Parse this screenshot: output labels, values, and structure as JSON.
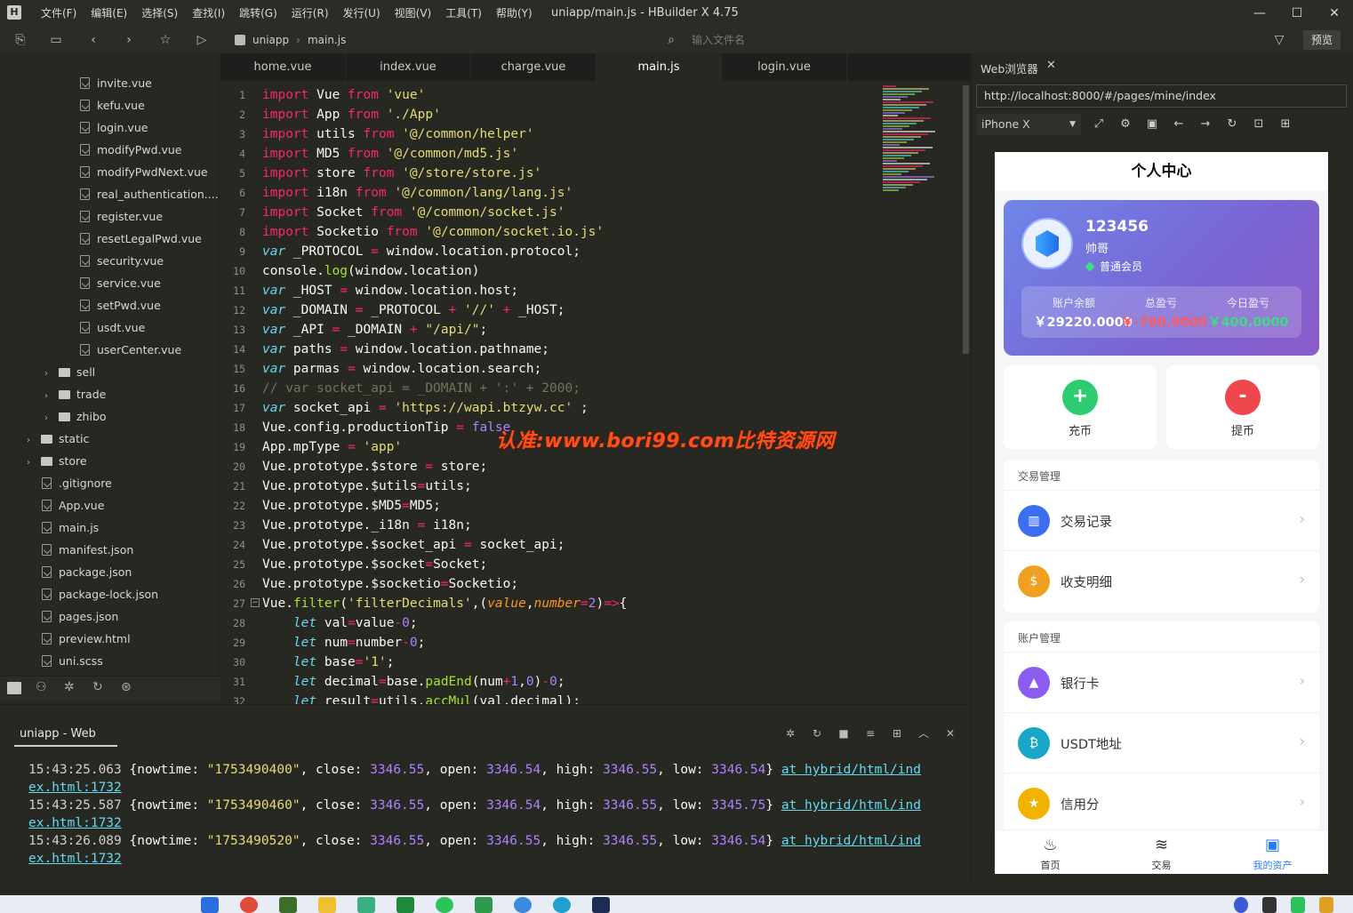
{
  "window": {
    "title": "uniapp/main.js - HBuilder X 4.75",
    "logo": "H",
    "menu": [
      "文件(F)",
      "编辑(E)",
      "选择(S)",
      "查找(I)",
      "跳转(G)",
      "运行(R)",
      "发行(U)",
      "视图(V)",
      "工具(T)",
      "帮助(Y)"
    ]
  },
  "toolbar": {
    "breadcrumb": [
      "uniapp",
      "main.js"
    ],
    "file_search_placeholder": "输入文件名",
    "preview_label": "预览"
  },
  "sidebar": {
    "files": [
      {
        "name": "invite.vue",
        "type": "file",
        "indent": 2
      },
      {
        "name": "kefu.vue",
        "type": "file",
        "indent": 2
      },
      {
        "name": "login.vue",
        "type": "file",
        "indent": 2
      },
      {
        "name": "modifyPwd.vue",
        "type": "file",
        "indent": 2
      },
      {
        "name": "modifyPwdNext.vue",
        "type": "file",
        "indent": 2
      },
      {
        "name": "real_authentication....",
        "type": "file",
        "indent": 2
      },
      {
        "name": "register.vue",
        "type": "file",
        "indent": 2
      },
      {
        "name": "resetLegalPwd.vue",
        "type": "file",
        "indent": 2
      },
      {
        "name": "security.vue",
        "type": "file",
        "indent": 2
      },
      {
        "name": "service.vue",
        "type": "file",
        "indent": 2
      },
      {
        "name": "setPwd.vue",
        "type": "file",
        "indent": 2
      },
      {
        "name": "usdt.vue",
        "type": "file",
        "indent": 2
      },
      {
        "name": "userCenter.vue",
        "type": "file",
        "indent": 2
      },
      {
        "name": "sell",
        "type": "folder",
        "indent": 1
      },
      {
        "name": "trade",
        "type": "folder",
        "indent": 1
      },
      {
        "name": "zhibo",
        "type": "folder",
        "indent": 1
      },
      {
        "name": "static",
        "type": "folder",
        "indent": 0
      },
      {
        "name": "store",
        "type": "folder",
        "indent": 0
      },
      {
        "name": ".gitignore",
        "type": "plain",
        "indent": 0
      },
      {
        "name": "App.vue",
        "type": "file",
        "indent": 0
      },
      {
        "name": "main.js",
        "type": "file",
        "indent": 0
      },
      {
        "name": "manifest.json",
        "type": "json",
        "indent": 0
      },
      {
        "name": "package.json",
        "type": "json",
        "indent": 0
      },
      {
        "name": "package-lock.json",
        "type": "json",
        "indent": 0
      },
      {
        "name": "pages.json",
        "type": "json",
        "indent": 0
      },
      {
        "name": "preview.html",
        "type": "html",
        "indent": 0
      },
      {
        "name": "uni.scss",
        "type": "scss",
        "indent": 0
      }
    ]
  },
  "editor": {
    "tabs": [
      "home.vue",
      "index.vue",
      "charge.vue",
      "main.js",
      "login.vue"
    ],
    "active_tab": "main.js",
    "line_numbers": [
      "1",
      "2",
      "3",
      "4",
      "5",
      "6",
      "7",
      "8",
      "9",
      "10",
      "11",
      "12",
      "13",
      "14",
      "15",
      "16",
      "17",
      "18",
      "19",
      "20",
      "21",
      "22",
      "23",
      "24",
      "25",
      "26",
      "27",
      "28",
      "29",
      "30",
      "31",
      "32"
    ],
    "lines": [
      [
        [
          "k",
          "import"
        ],
        [
          "t",
          " Vue "
        ],
        [
          "k",
          "from"
        ],
        [
          "t",
          " "
        ],
        [
          "s",
          "'vue'"
        ]
      ],
      [
        [
          "k",
          "import"
        ],
        [
          "t",
          " App "
        ],
        [
          "k",
          "from"
        ],
        [
          "t",
          " "
        ],
        [
          "s",
          "'./App'"
        ]
      ],
      [
        [
          "k",
          "import"
        ],
        [
          "t",
          " utils "
        ],
        [
          "k",
          "from"
        ],
        [
          "t",
          " "
        ],
        [
          "s",
          "'@/common/helper'"
        ]
      ],
      [
        [
          "k",
          "import"
        ],
        [
          "t",
          " MD5 "
        ],
        [
          "k",
          "from"
        ],
        [
          "t",
          " "
        ],
        [
          "s",
          "'@/common/md5.js'"
        ]
      ],
      [
        [
          "k",
          "import"
        ],
        [
          "t",
          " store "
        ],
        [
          "k",
          "from"
        ],
        [
          "t",
          " "
        ],
        [
          "s",
          "'@/store/store.js'"
        ]
      ],
      [
        [
          "k",
          "import"
        ],
        [
          "t",
          " i18n "
        ],
        [
          "k",
          "from"
        ],
        [
          "t",
          " "
        ],
        [
          "s",
          "'@/common/lang/lang.js'"
        ]
      ],
      [
        [
          "k",
          "import"
        ],
        [
          "t",
          " Socket "
        ],
        [
          "k",
          "from"
        ],
        [
          "t",
          " "
        ],
        [
          "s",
          "'@/common/socket.js'"
        ]
      ],
      [
        [
          "k",
          "import"
        ],
        [
          "t",
          " Socketio "
        ],
        [
          "k",
          "from"
        ],
        [
          "t",
          " "
        ],
        [
          "s",
          "'@/common/socket.io.js'"
        ]
      ],
      [
        [
          "v",
          "var"
        ],
        [
          "t",
          " _PROTOCOL "
        ],
        [
          "k",
          "="
        ],
        [
          "t",
          " window.location.protocol;"
        ]
      ],
      [
        [
          "t",
          "console."
        ],
        [
          "f",
          "log"
        ],
        [
          "t",
          "(window.location)"
        ]
      ],
      [
        [
          "v",
          "var"
        ],
        [
          "t",
          " _HOST "
        ],
        [
          "k",
          "="
        ],
        [
          "t",
          " window.location.host;"
        ]
      ],
      [
        [
          "v",
          "var"
        ],
        [
          "t",
          " _DOMAIN "
        ],
        [
          "k",
          "="
        ],
        [
          "t",
          " _PROTOCOL "
        ],
        [
          "k",
          "+"
        ],
        [
          "t",
          " "
        ],
        [
          "s",
          "'//'"
        ],
        [
          "t",
          " "
        ],
        [
          "k",
          "+"
        ],
        [
          "t",
          " _HOST;"
        ]
      ],
      [
        [
          "v",
          "var"
        ],
        [
          "t",
          " _API "
        ],
        [
          "k",
          "="
        ],
        [
          "t",
          " _DOMAIN "
        ],
        [
          "k",
          "+"
        ],
        [
          "t",
          " "
        ],
        [
          "s",
          "\"/api/\""
        ],
        [
          "t",
          ";"
        ]
      ],
      [
        [
          "v",
          "var"
        ],
        [
          "t",
          " paths "
        ],
        [
          "k",
          "="
        ],
        [
          "t",
          " window.location.pathname;"
        ]
      ],
      [
        [
          "v",
          "var"
        ],
        [
          "t",
          " parmas "
        ],
        [
          "k",
          "="
        ],
        [
          "t",
          " window.location.search;"
        ]
      ],
      [
        [
          "c",
          "// var socket_api = _DOMAIN + ':' + 2000;"
        ]
      ],
      [
        [
          "v",
          "var"
        ],
        [
          "t",
          " socket_api "
        ],
        [
          "k",
          "="
        ],
        [
          "t",
          " "
        ],
        [
          "s",
          "'https://wapi.btzyw.cc'"
        ],
        [
          "t",
          " ;"
        ]
      ],
      [
        [
          "t",
          "Vue.config.productionTip "
        ],
        [
          "k",
          "="
        ],
        [
          "t",
          " "
        ],
        [
          "n",
          "false"
        ]
      ],
      [
        [
          "t",
          "App.mpType "
        ],
        [
          "k",
          "="
        ],
        [
          "t",
          " "
        ],
        [
          "s",
          "'app'"
        ]
      ],
      [
        [
          "t",
          "Vue.prototype.$store "
        ],
        [
          "k",
          "="
        ],
        [
          "t",
          " store;"
        ]
      ],
      [
        [
          "t",
          "Vue.prototype.$utils"
        ],
        [
          "k",
          "="
        ],
        [
          "t",
          "utils;"
        ]
      ],
      [
        [
          "t",
          "Vue.prototype.$MD5"
        ],
        [
          "k",
          "="
        ],
        [
          "t",
          "MD5;"
        ]
      ],
      [
        [
          "t",
          "Vue.prototype._i18n "
        ],
        [
          "k",
          "="
        ],
        [
          "t",
          " i18n;"
        ]
      ],
      [
        [
          "t",
          "Vue.prototype.$socket_api "
        ],
        [
          "k",
          "="
        ],
        [
          "t",
          " socket_api;"
        ]
      ],
      [
        [
          "t",
          "Vue.prototype.$socket"
        ],
        [
          "k",
          "="
        ],
        [
          "t",
          "Socket;"
        ]
      ],
      [
        [
          "t",
          "Vue.prototype.$socketio"
        ],
        [
          "k",
          "="
        ],
        [
          "t",
          "Socketio;"
        ]
      ],
      [
        [
          "t",
          "Vue."
        ],
        [
          "f",
          "filter"
        ],
        [
          "t",
          "("
        ],
        [
          "s",
          "'filterDecimals'"
        ],
        [
          "t",
          ",("
        ],
        [
          "p",
          "value"
        ],
        [
          "t",
          ","
        ],
        [
          "p",
          "number"
        ],
        [
          "k",
          "="
        ],
        [
          "n",
          "2"
        ],
        [
          "t",
          ")"
        ],
        [
          "k",
          "=>"
        ],
        [
          "t",
          "{"
        ]
      ],
      [
        [
          "t",
          "    "
        ],
        [
          "v",
          "let"
        ],
        [
          "t",
          " val"
        ],
        [
          "k",
          "="
        ],
        [
          "t",
          "value"
        ],
        [
          "k",
          "-"
        ],
        [
          "n",
          "0"
        ],
        [
          "t",
          ";"
        ]
      ],
      [
        [
          "t",
          "    "
        ],
        [
          "v",
          "let"
        ],
        [
          "t",
          " num"
        ],
        [
          "k",
          "="
        ],
        [
          "t",
          "number"
        ],
        [
          "k",
          "-"
        ],
        [
          "n",
          "0"
        ],
        [
          "t",
          ";"
        ]
      ],
      [
        [
          "t",
          "    "
        ],
        [
          "v",
          "let"
        ],
        [
          "t",
          " base"
        ],
        [
          "k",
          "="
        ],
        [
          "s",
          "'1'"
        ],
        [
          "t",
          ";"
        ]
      ],
      [
        [
          "t",
          "    "
        ],
        [
          "v",
          "let"
        ],
        [
          "t",
          " decimal"
        ],
        [
          "k",
          "="
        ],
        [
          "t",
          "base."
        ],
        [
          "f",
          "padEnd"
        ],
        [
          "t",
          "(num"
        ],
        [
          "k",
          "+"
        ],
        [
          "n",
          "1"
        ],
        [
          "t",
          ","
        ],
        [
          "n",
          "0"
        ],
        [
          "t",
          ")"
        ],
        [
          "k",
          "-"
        ],
        [
          "n",
          "0"
        ],
        [
          "t",
          ";"
        ]
      ],
      [
        [
          "t",
          "    "
        ],
        [
          "v",
          "let"
        ],
        [
          "t",
          " result"
        ],
        [
          "k",
          "="
        ],
        [
          "t",
          "utils."
        ],
        [
          "f",
          "accMul"
        ],
        [
          "t",
          "(val,decimal);"
        ]
      ]
    ],
    "watermark": "认准:www.bori99.com比特资源网"
  },
  "console": {
    "tab_label": "uniapp - Web",
    "logs": [
      {
        "time": "15:43:25.063",
        "nowtime": "\"1753490400\"",
        "close": "3346.55",
        "open": "3346.54",
        "high": "3346.55",
        "low": "3346.54",
        "link1": "at hybrid/html/ind",
        "link2": "ex.html:1732"
      },
      {
        "time": "15:43:25.587",
        "nowtime": "\"1753490460\"",
        "close": "3346.55",
        "open": "3346.54",
        "high": "3346.55",
        "low": "3345.75",
        "link1": "at hybrid/html/ind",
        "link2": "ex.html:1732"
      },
      {
        "time": "15:43:26.089",
        "nowtime": "\"1753490520\"",
        "close": "3346.55",
        "open": "3346.55",
        "high": "3346.55",
        "low": "3346.54",
        "link1": "at hybrid/html/ind",
        "link2": "ex.html:1732"
      }
    ]
  },
  "browser": {
    "tab_label": "Web浏览器",
    "url": "http://localhost:8000/#/pages/mine/index",
    "device": "iPhone X"
  },
  "app": {
    "page_title": "个人中心",
    "user_id": "123456",
    "nickname": "帅哥",
    "membership": "普通会员",
    "stats": [
      {
        "label": "账户余额",
        "value": "￥29220.0000",
        "color": "#ffffff"
      },
      {
        "label": "总盈亏",
        "value": "￥-780.0000",
        "color": "#ff5a5a"
      },
      {
        "label": "今日盈亏",
        "value": "￥400.0000",
        "color": "#3ddc84"
      }
    ],
    "actions": [
      {
        "label": "充币",
        "symbol": "+",
        "color": "#2ecc71"
      },
      {
        "label": "提币",
        "symbol": "-",
        "color": "#f0474f"
      }
    ],
    "sections": [
      {
        "title": "交易管理",
        "items": [
          {
            "label": "交易记录",
            "icon": "chart-icon",
            "color": "#3b6ff0",
            "glyph": "▥"
          },
          {
            "label": "收支明细",
            "icon": "moneybag-icon",
            "color": "#f0a020",
            "glyph": "$"
          }
        ]
      },
      {
        "title": "账户管理",
        "items": [
          {
            "label": "银行卡",
            "icon": "bank-icon",
            "color": "#8a5cf0",
            "glyph": "▲"
          },
          {
            "label": "USDT地址",
            "icon": "bitcoin-icon",
            "color": "#1aa6c9",
            "glyph": "₿"
          },
          {
            "label": "信用分",
            "icon": "star-icon",
            "color": "#f0b400",
            "glyph": "★"
          }
        ]
      }
    ],
    "tabbar": [
      {
        "label": "首页",
        "icon": "flame-icon",
        "glyph": "♨",
        "active": false
      },
      {
        "label": "交易",
        "icon": "trade-icon",
        "glyph": "≋",
        "active": false
      },
      {
        "label": "我的资产",
        "icon": "wallet-icon",
        "glyph": "▣",
        "active": true
      }
    ],
    "accent": "#2a7cf6"
  }
}
